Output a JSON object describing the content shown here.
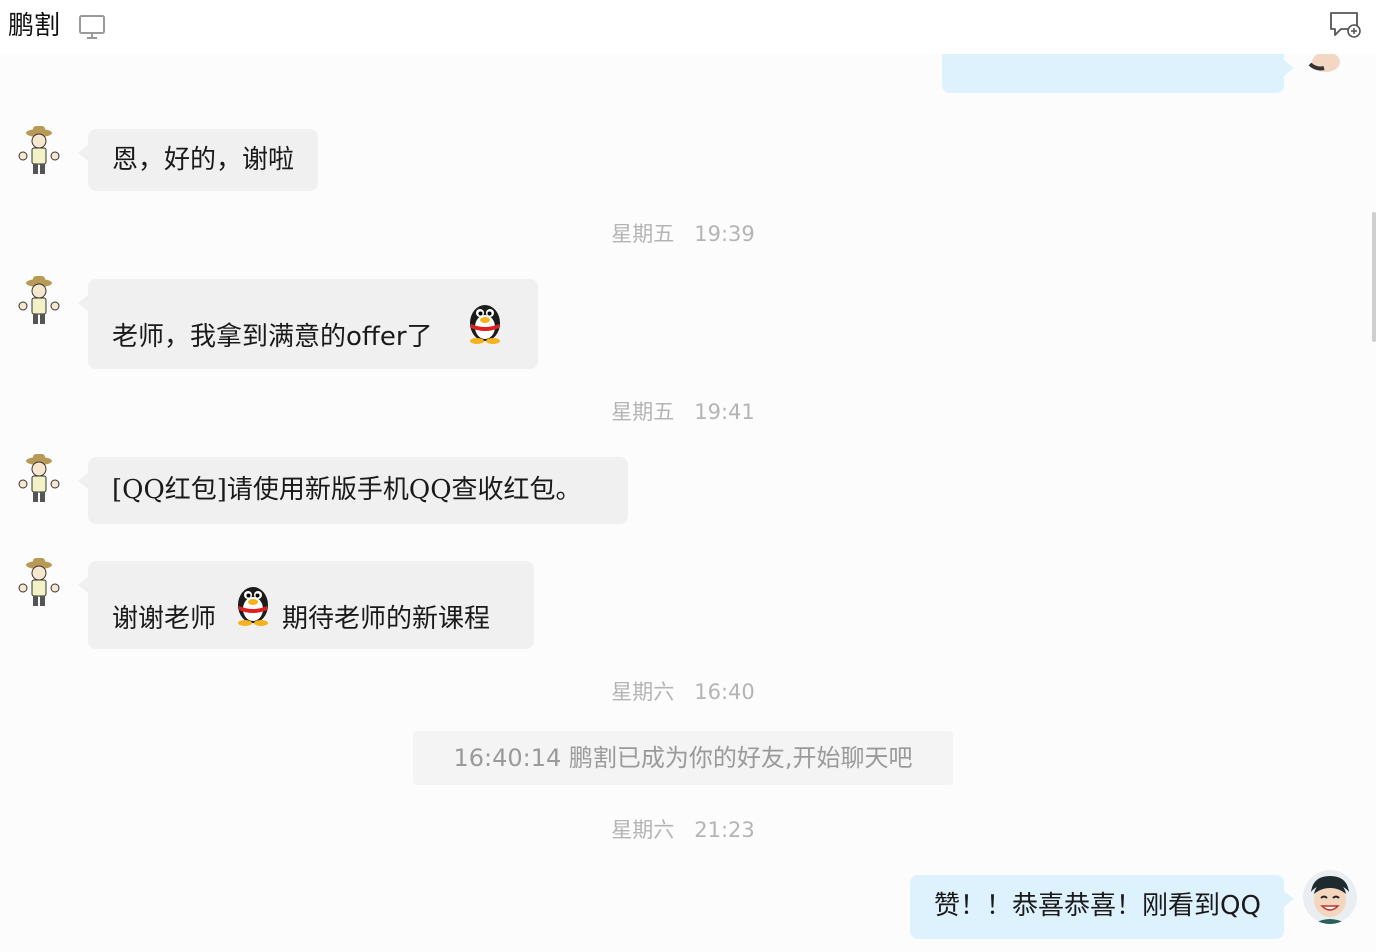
{
  "header": {
    "title": "鹏割",
    "device_icon": "monitor-icon",
    "action_icon": "new-chat-icon"
  },
  "colors": {
    "incoming_bubble": "#f0f0f0",
    "outgoing_bubble": "#def2fd",
    "timestamp": "#b4b4b4"
  },
  "messages": [
    {
      "side": "right",
      "text": ""
    },
    {
      "side": "left",
      "text": "恩，好的，谢啦"
    },
    {
      "time": "星期五   19:39"
    },
    {
      "side": "left",
      "text": "老师，我拿到满意的offer了",
      "emoji": "qq-penguin-icon"
    },
    {
      "time": "星期五   19:41"
    },
    {
      "side": "left",
      "text": "[QQ红包]请使用新版手机QQ查收红包。"
    },
    {
      "side": "left",
      "text_before": "谢谢老师",
      "emoji": "qq-penguin-icon",
      "text_after": "期待老师的新课程"
    },
    {
      "time": "星期六   16:40"
    },
    {
      "system": "16:40:14 鹏割已成为你的好友,开始聊天吧"
    },
    {
      "time": "星期六   21:23"
    },
    {
      "side": "right",
      "text": "赞！！恭喜恭喜！刚看到QQ"
    }
  ]
}
